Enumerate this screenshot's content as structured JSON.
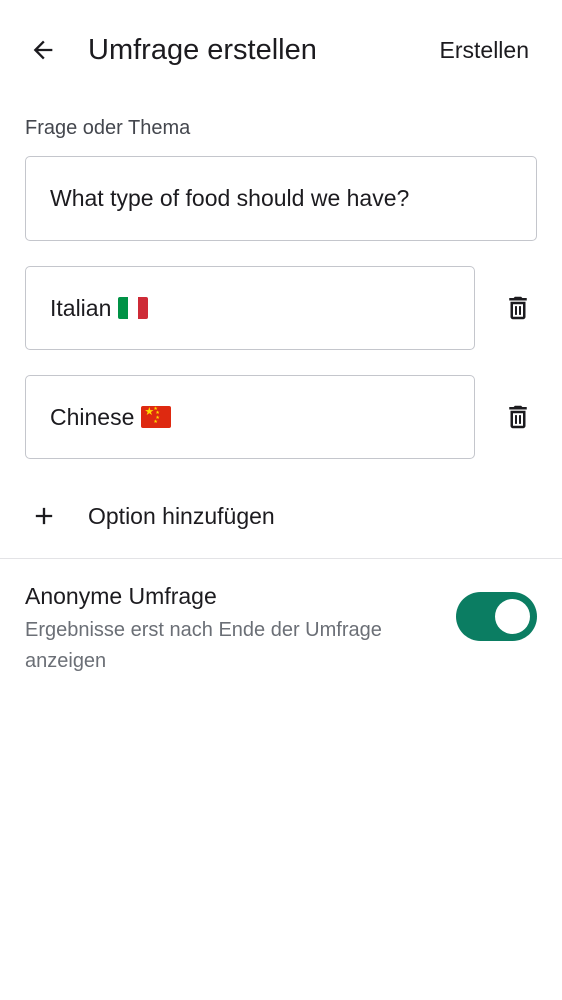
{
  "appbar": {
    "back_icon": "arrow-back-icon",
    "title": "Umfrage erstellen",
    "create_label": "Erstellen"
  },
  "question": {
    "label": "Frage oder Thema",
    "value": "What type of food should we have?"
  },
  "options": [
    {
      "text": "Italian",
      "flag": "IT",
      "delete_icon": "trash-icon"
    },
    {
      "text": "Chinese",
      "flag": "CN",
      "delete_icon": "trash-icon"
    }
  ],
  "add_option": {
    "icon": "plus-icon",
    "label": "Option hinzufügen"
  },
  "anonymous": {
    "title": "Anonyme Umfrage",
    "description": "Ergebnisse erst nach Ende der Umfrage anzeigen",
    "enabled": true
  },
  "colors": {
    "accent": "#0b7d62",
    "text_primary": "#1c1b1f",
    "text_secondary": "#6b6f76",
    "border": "#c4c6cc"
  }
}
